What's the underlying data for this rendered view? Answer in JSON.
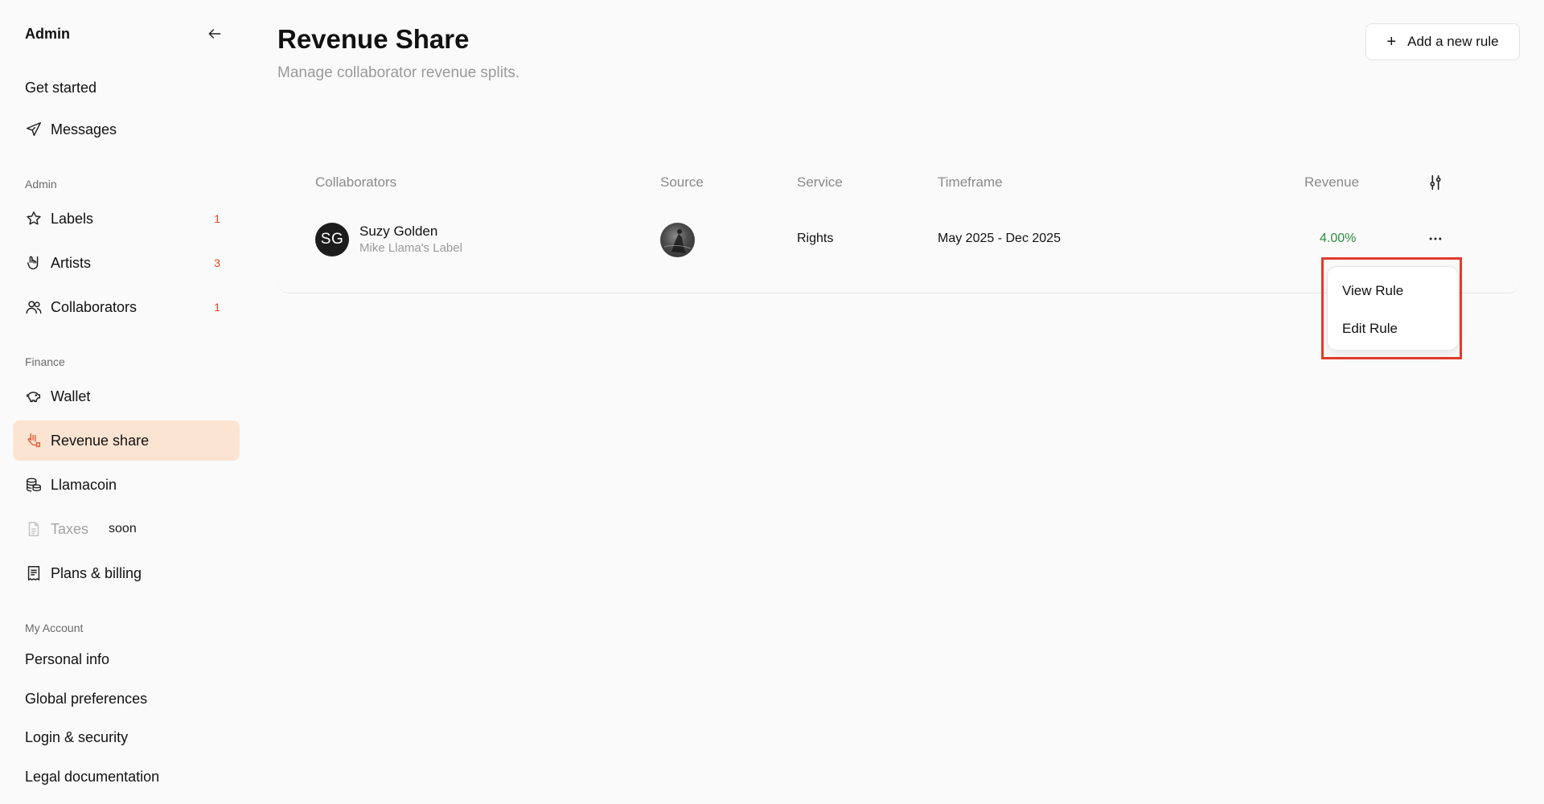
{
  "sidebar": {
    "title": "Admin",
    "items_top": [
      {
        "label": "Get started"
      },
      {
        "label": "Messages"
      }
    ],
    "section_admin": "Admin",
    "admin_items": [
      {
        "label": "Labels",
        "badge": "1"
      },
      {
        "label": "Artists",
        "badge": "3"
      },
      {
        "label": "Collaborators",
        "badge": "1"
      }
    ],
    "section_finance": "Finance",
    "finance_items": [
      {
        "label": "Wallet"
      },
      {
        "label": "Revenue share"
      },
      {
        "label": "Llamacoin"
      },
      {
        "label": "Taxes",
        "tag": "soon"
      },
      {
        "label": "Plans & billing"
      }
    ],
    "section_account": "My Account",
    "account_items": [
      {
        "label": "Personal info"
      },
      {
        "label": "Global preferences"
      },
      {
        "label": "Login & security"
      },
      {
        "label": "Legal documentation"
      }
    ]
  },
  "main": {
    "title": "Revenue Share",
    "subtitle": "Manage collaborator revenue splits.",
    "add_button": "Add a new rule",
    "table": {
      "headers": [
        "Collaborators",
        "Source",
        "Service",
        "Timeframe",
        "Revenue"
      ],
      "rows": [
        {
          "initials": "SG",
          "name": "Suzy Golden",
          "label": "Mike Llama's Label",
          "service": "Rights",
          "timeframe": "May 2025 - Dec 2025",
          "revenue": "4.00%"
        }
      ]
    },
    "row_menu": {
      "items": [
        "View Rule",
        "Edit Rule"
      ]
    }
  },
  "colors": {
    "accent_active_bg": "#fbe4d2",
    "accent_icon": "#e0603a",
    "badge": "#d9452b",
    "revenue_positive": "#2e8b3e",
    "highlight_box": "#e03b2a"
  },
  "icons": {
    "collapse": "arrow-left-icon",
    "messages": "paper-plane-icon",
    "labels": "star-icon",
    "artists": "rock-hand-icon",
    "collaborators": "users-icon",
    "wallet": "piggy-bank-icon",
    "revenue_share": "hand-coin-icon",
    "llamacoin": "coins-icon",
    "taxes": "document-icon",
    "plans": "receipt-icon",
    "filter": "sliders-icon",
    "more": "more-horizontal-icon"
  }
}
